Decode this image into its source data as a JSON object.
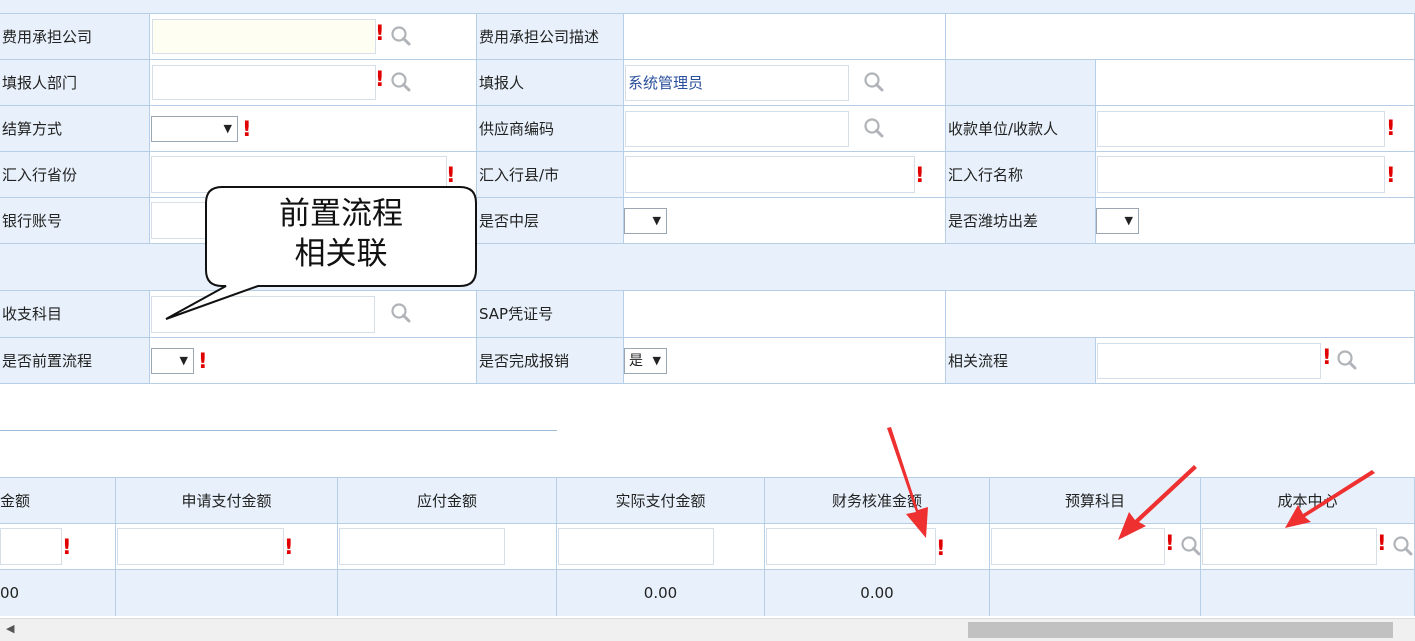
{
  "form": {
    "cost_company_label": "费用承担公司",
    "cost_company_desc_label": "费用承担公司描述",
    "reporter_dept_label": "填报人部门",
    "reporter_label": "填报人",
    "reporter_value": "系统管理员",
    "settlement_label": "结算方式",
    "supplier_code_label": "供应商编码",
    "payee_label": "收款单位/收款人",
    "bank_province_label": "汇入行省份",
    "bank_city_label": "汇入行县/市",
    "bank_name_label": "汇入行名称",
    "bank_account_label": "银行账号",
    "is_middle_label": "是否中层",
    "is_weifang_label": "是否潍坊出差",
    "account_subject_label": "收支科目",
    "sap_voucher_label": "SAP凭证号",
    "is_pre_process_label": "是否前置流程",
    "is_completed_label": "是否完成报销",
    "is_completed_value": "是",
    "related_process_label": "相关流程"
  },
  "callout": {
    "line1": "前置流程",
    "line2": "相关联"
  },
  "table": {
    "headers": [
      "金额",
      "申请支付金额",
      "应付金额",
      "实际支付金额",
      "财务核准金额",
      "预算科目",
      "成本中心"
    ],
    "totals": {
      "col0": "00",
      "actual_paid": "0.00",
      "finance_approved": "0.00"
    }
  },
  "colors": {
    "label_bg": "#e8f1fb",
    "border": "#b7cfe6",
    "required": "#e00000",
    "link_text": "#2a4f9c",
    "annotation": "#ee3030"
  },
  "icons": {
    "search": "magnifier-icon",
    "required": "exclamation-icon",
    "dropdown": "caret-down-icon"
  }
}
